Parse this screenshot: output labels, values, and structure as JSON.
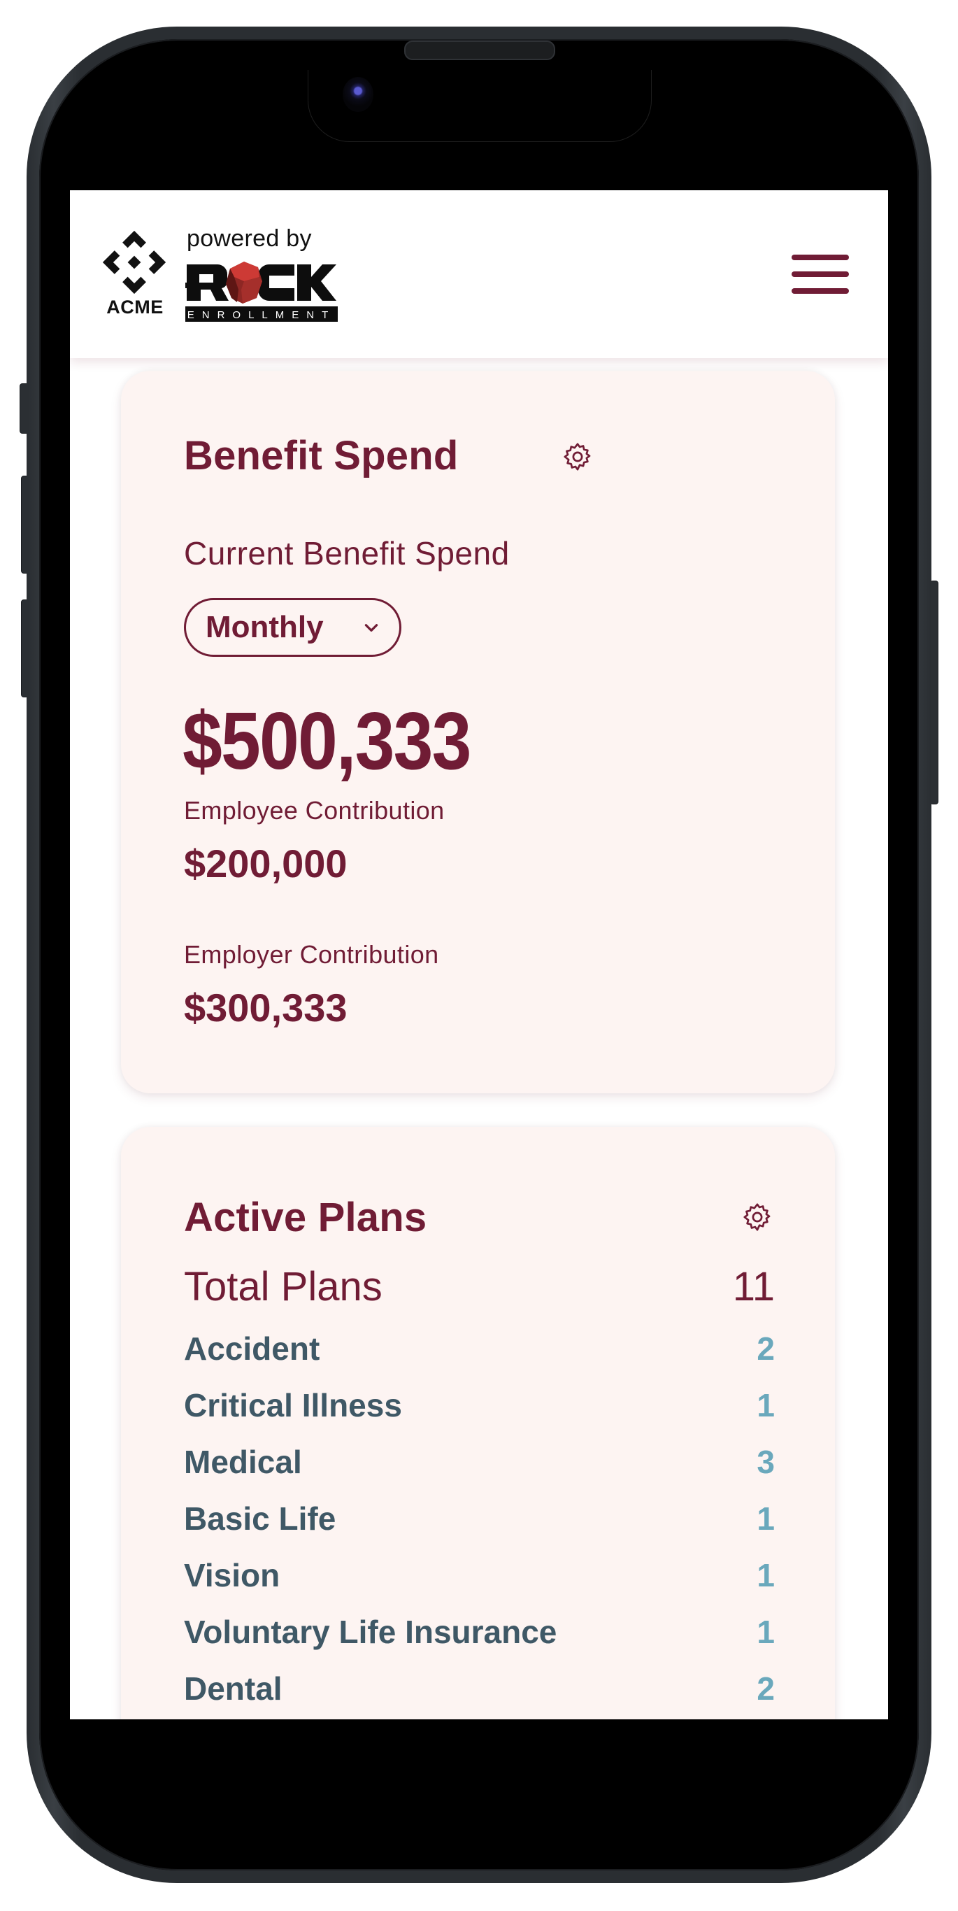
{
  "header": {
    "client_logo_text": "ACME",
    "powered_by_label": "powered by",
    "brand_logo_text": "ROCK",
    "brand_logo_subtext": "ENROLLMENT",
    "menu_icon": "hamburger-menu-icon"
  },
  "benefit_spend": {
    "title": "Benefit Spend",
    "settings_icon": "gear-icon",
    "current_label": "Current Benefit Spend",
    "period_select": {
      "value": "Monthly",
      "icon": "chevron-down-icon"
    },
    "total": "$500,333",
    "employee_label": "Employee Contribution",
    "employee_amount": "$200,000",
    "employer_label": "Employer Contribution",
    "employer_amount": "$300,333"
  },
  "active_plans": {
    "title": "Active Plans",
    "settings_icon": "gear-icon",
    "total_label": "Total Plans",
    "total_value": "11",
    "plans": [
      {
        "label": "Accident",
        "value": "2"
      },
      {
        "label": "Critical Illness",
        "value": "1"
      },
      {
        "label": "Medical",
        "value": "3"
      },
      {
        "label": "Basic Life",
        "value": "1"
      },
      {
        "label": "Vision",
        "value": "1"
      },
      {
        "label": "Voluntary Life Insurance",
        "value": "1"
      },
      {
        "label": "Dental",
        "value": "2"
      }
    ]
  },
  "colors": {
    "brand_maroon": "#701C35",
    "card_background": "#FDF4F2",
    "plan_label": "#3F5866",
    "plan_value": "#6AA8BC",
    "rock_red": "#C8332F"
  }
}
